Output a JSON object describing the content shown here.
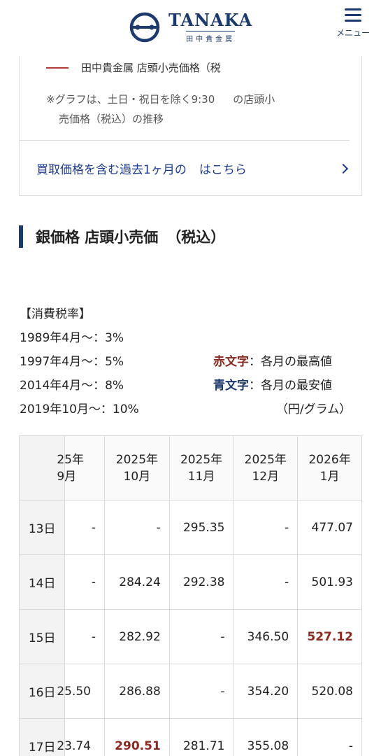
{
  "header": {
    "brand": "TANAKA",
    "brand_sub": "田中貴金属",
    "menu_label": "メニュー"
  },
  "chart_legend": {
    "label": "田中貴金属 店頭小売価格（税",
    "line_color": "#b23a3a"
  },
  "note": {
    "line1": "※グラフは、土日・祝日を除く9:30",
    "line1_end": "の店頭小",
    "line2": "売価格（税込）の推移"
  },
  "link": {
    "label": "買取価格を含む過去1ヶ月の",
    "label_end": "はこちら"
  },
  "section": {
    "title": "銀価格 店頭小売価",
    "title_end": "（税込）"
  },
  "tax": {
    "heading": "【消費税率】",
    "rates": [
      "1989年4月〜：3%",
      "1997年4月〜：5%",
      "2014年4月〜：8%",
      "2019年10月〜：10%"
    ]
  },
  "color_notes": {
    "red_label": "赤文字",
    "red_text": "：各月の最高値",
    "blue_label": "青文字",
    "blue_text": "：各月の最安値",
    "unit": "（円/グラム）"
  },
  "table": {
    "columns": [
      {
        "year": "25年",
        "month": "9月"
      },
      {
        "year": "2025年",
        "month": "10月"
      },
      {
        "year": "2025年",
        "month": "11月"
      },
      {
        "year": "2025年",
        "month": "12月"
      },
      {
        "year": "2026年",
        "month": "1月"
      }
    ],
    "rows": [
      {
        "day": "13日",
        "cells": [
          "-",
          "-",
          "295.35",
          "-",
          "477.07"
        ]
      },
      {
        "day": "14日",
        "cells": [
          "-",
          "284.24",
          "292.38",
          "-",
          "501.93"
        ]
      },
      {
        "day": "15日",
        "cells": [
          "-",
          "282.92",
          "-",
          "346.50",
          "527.12"
        ]
      },
      {
        "day": "16日",
        "cells": [
          "25.50",
          "286.88",
          "-",
          "354.20",
          "520.08"
        ]
      },
      {
        "day": "17日",
        "cells": [
          "23.74",
          "290.51",
          "281.71",
          "355.08",
          "-"
        ]
      }
    ],
    "highlights": {
      "high_color": "#8a2a20",
      "low_color": "#1d3a6e"
    }
  }
}
